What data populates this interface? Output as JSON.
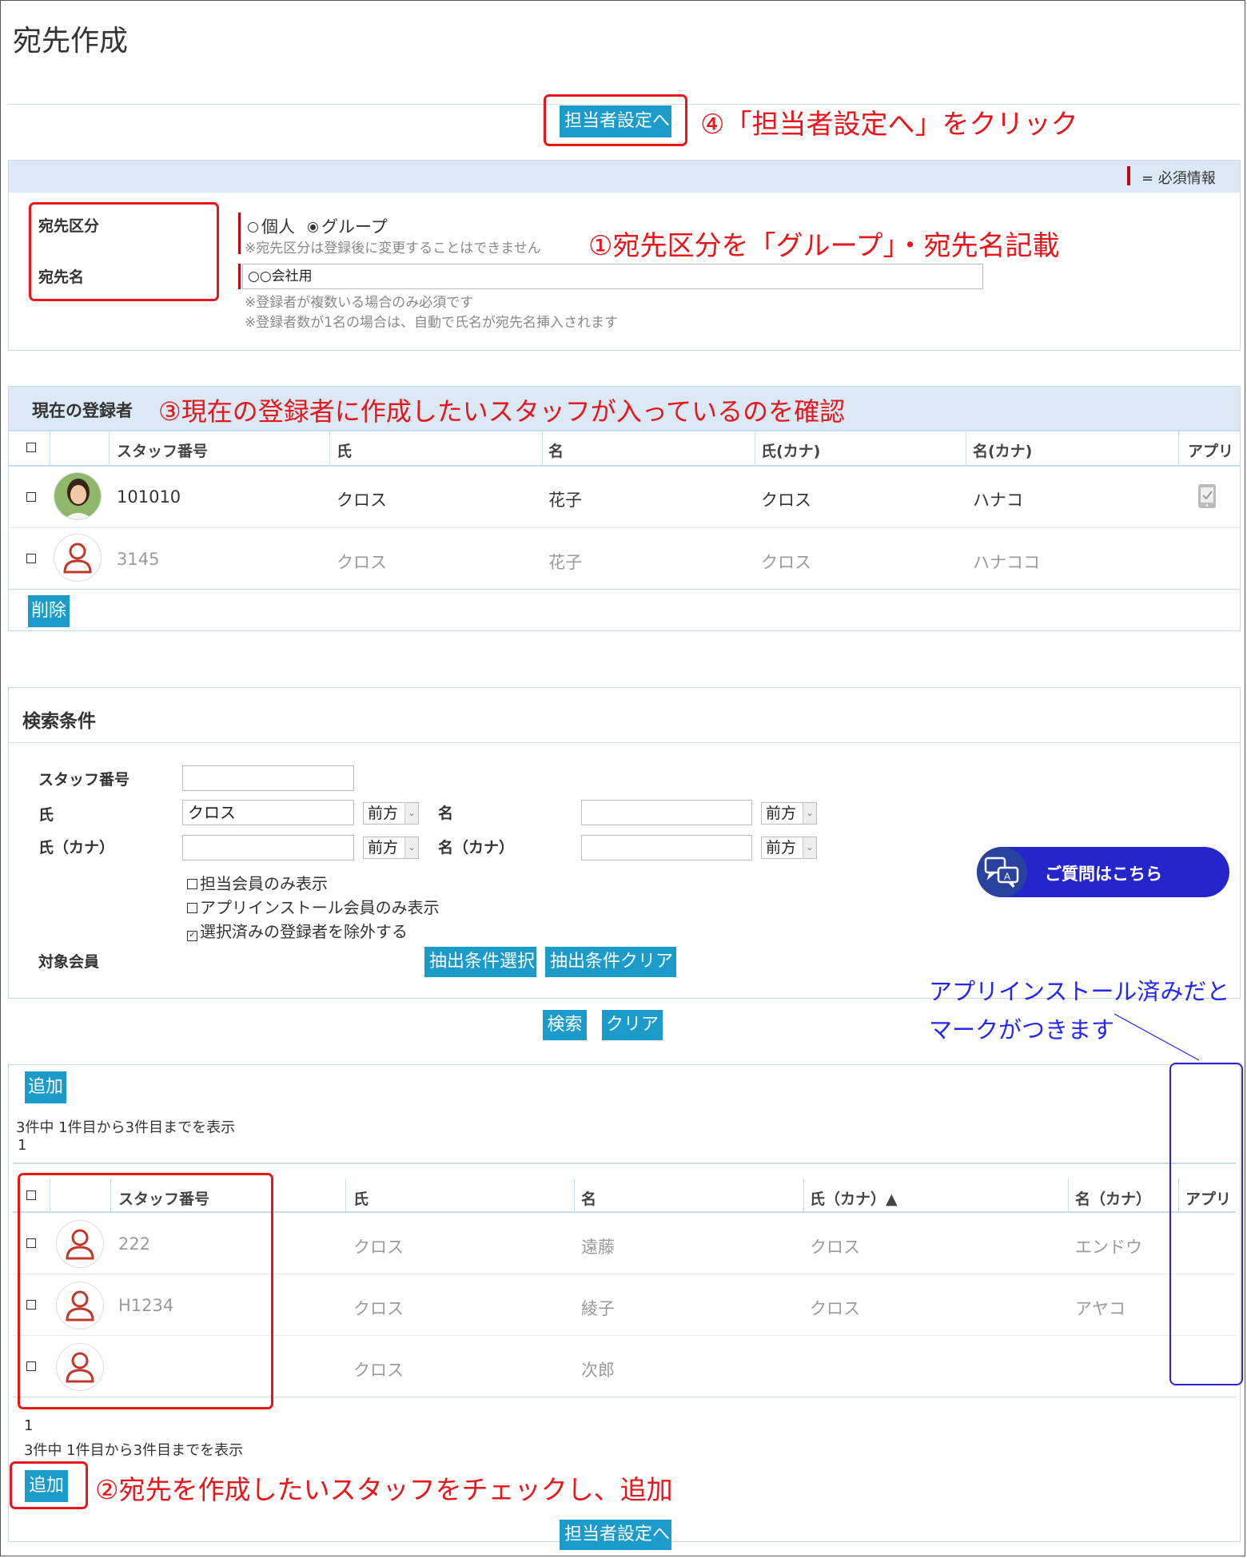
{
  "page": {
    "title": "宛先作成",
    "assign_button": "担当者設定へ",
    "assign_button_bottom": "担当者設定へ"
  },
  "annotations": {
    "step4": "④「担当者設定へ」をクリック",
    "step1": "①宛先区分を「グループ」・宛先名記載",
    "step3": "③現在の登録者に作成したいスタッフが入っているのを確認",
    "step2": "②宛先を作成したいスタッフをチェックし、追加",
    "app_note_line1": "アプリインストール済みだと",
    "app_note_line2": "マークがつきます"
  },
  "form": {
    "required_legend": "= 必須情報",
    "type_label": "宛先区分",
    "type_options": [
      "個人",
      "グループ"
    ],
    "type_selected": "グループ",
    "type_note": "※宛先区分は登録後に変更することはできません",
    "name_label": "宛先名",
    "name_value": "○○会社用",
    "name_note1": "※登録者が複数いる場合のみ必須です",
    "name_note2": "※登録者数が1名の場合は、自動で氏名が宛先名挿入されます"
  },
  "current": {
    "heading": "現在の登録者",
    "columns": [
      "スタッフ番号",
      "氏",
      "名",
      "氏(カナ)",
      "名(カナ)",
      "アプリ"
    ],
    "rows": [
      {
        "staff_no": "101010",
        "last": "クロス",
        "first": "花子",
        "last_kana": "クロス",
        "first_kana": "ハナコ",
        "app": true,
        "photo": true
      },
      {
        "staff_no": "3145",
        "last": "クロス",
        "first": "花子",
        "last_kana": "クロス",
        "first_kana": "ハナココ",
        "app": false,
        "photo": false
      }
    ],
    "delete_button": "削除"
  },
  "search": {
    "heading": "検索条件",
    "staff_no_label": "スタッフ番号",
    "staff_no_value": "",
    "last_label": "氏",
    "last_value": "クロス",
    "last_match": "前方",
    "first_label": "名",
    "first_value": "",
    "first_match": "前方",
    "last_kana_label": "氏（カナ）",
    "last_kana_value": "",
    "last_kana_match": "前方",
    "first_kana_label": "名（カナ）",
    "first_kana_value": "",
    "first_kana_match": "前方",
    "options": [
      {
        "label": "担当会員のみ表示",
        "checked": false
      },
      {
        "label": "アプリインストール会員のみ表示",
        "checked": false
      },
      {
        "label": "選択済みの登録者を除外する",
        "checked": true
      }
    ],
    "target_label": "対象会員",
    "extract_select_button": "抽出条件選択",
    "extract_clear_button": "抽出条件クリア",
    "search_button": "検索",
    "clear_button": "クリア",
    "help_button": "ご質問はこちら"
  },
  "results": {
    "add_button_top": "追加",
    "summary_top": "3件中 1件目から3件目までを表示",
    "page_top": "1",
    "columns": [
      "スタッフ番号",
      "氏",
      "名",
      "氏（カナ）▲",
      "名（カナ）",
      "アプリ"
    ],
    "rows": [
      {
        "staff_no": "222",
        "last": "クロス",
        "first": "遠藤",
        "last_kana": "クロス",
        "first_kana": "エンドウ"
      },
      {
        "staff_no": "H1234",
        "last": "クロス",
        "first": "綾子",
        "last_kana": "クロス",
        "first_kana": "アヤコ"
      },
      {
        "staff_no": "",
        "last": "クロス",
        "first": "次郎",
        "last_kana": "",
        "first_kana": ""
      }
    ],
    "page_bottom": "1",
    "summary_bottom": "3件中 1件目から3件目までを表示",
    "add_button_bottom": "追加"
  }
}
